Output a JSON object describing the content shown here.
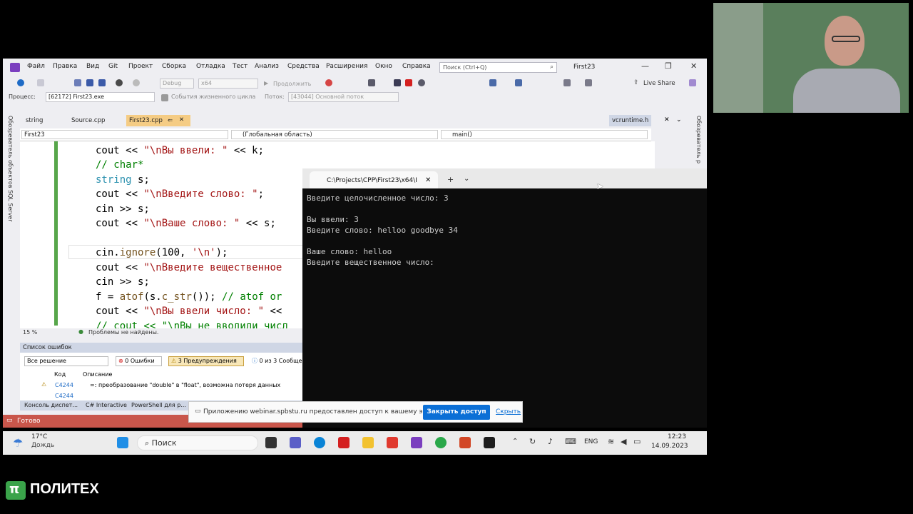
{
  "vs": {
    "menu": [
      "Файл",
      "Правка",
      "Вид",
      "Git",
      "Проект",
      "Сборка",
      "Отладка",
      "Тест",
      "Анализ",
      "Средства",
      "Расширения",
      "Окно",
      "Справка"
    ],
    "search_placeholder": "Поиск (Ctrl+Q)",
    "solution_title": "First23",
    "toolbar": {
      "config": "Debug",
      "platform": "x64",
      "continue_label": "Продолжить",
      "live_share": "Live Share",
      "process_label": "Процесс:",
      "process_value": "[62172] First23.exe",
      "lifecycle_events": "События жизненного цикла",
      "thread_label": "Поток:",
      "thread_value": "[43044] Основной поток"
    },
    "doc_tabs": [
      "string",
      "Source.cpp",
      "First23.cpp",
      "vcruntime.h"
    ],
    "left_strip_text": "Обозреватель объектов SQL Server",
    "right_strip_text": "Обозреватель р",
    "nav": {
      "project": "First23",
      "scope": "(Глобальная область)",
      "member": "main()"
    },
    "code": {
      "l1": {
        "a": "cout << ",
        "b": "\"\\nВы ввели: \"",
        "c": " << k;"
      },
      "l2": "// char*",
      "l3": {
        "a": "string",
        "b": " s;"
      },
      "l4": {
        "a": "cout << ",
        "b": "\"\\nВведите слово: \"",
        "c": ";"
      },
      "l5": "cin >> s;",
      "l6": {
        "a": "cout << ",
        "b": "\"\\nВаше слово: \"",
        "c": " << s;"
      },
      "l7": {
        "a": "cin.",
        "b": "ignore",
        "c": "(100, ",
        "d": "'\\n'",
        "e": ");"
      },
      "l8": {
        "a": "cout << ",
        "b": "\"\\nВведите вещественное"
      },
      "l9": "cin >> s;",
      "l10": {
        "a": "f = ",
        "b": "atof",
        "c": "(s.",
        "d": "c_str",
        "e": "()); ",
        "f": "// atof or"
      },
      "l11": {
        "a": "cout << ",
        "b": "\"\\nВы ввели число: \"",
        "c": " <<"
      },
      "l12": "// cout << \"\\nВы не вводили числ"
    },
    "editor_status": {
      "zoom": "15 %",
      "problems": "Проблемы не найдены."
    },
    "error_list": {
      "title": "Список ошибок",
      "scope": "Все решение",
      "errors": "0 Ошибки",
      "warnings": "3 Предупреждения",
      "messages": "0 из 3 Сообще",
      "col_code": "Код",
      "col_desc": "Описание",
      "row_code": "C4244",
      "row_desc": "=: преобразование \"double\" в \"float\", возможна потеря данных",
      "row2_code": "C4244"
    },
    "bottom_tabs": [
      "Консоль диспет...",
      "C# Interactive",
      "PowerShell для р..."
    ],
    "status": "Готово"
  },
  "console": {
    "tab_title": "C:\\Projects\\CPP\\First23\\x64\\I",
    "lines": [
      "Введите целочисленное число: 3",
      "",
      "Вы ввели: 3",
      "Введите слово: helloo goodbye 34",
      "",
      "Ваше слово: helloo",
      "Введите вещественное число: "
    ]
  },
  "notification": {
    "text": "Приложению webinar.spbstu.ru предоставлен доступ к вашему экрану.",
    "button": "Закрыть доступ",
    "hide": "Скрыть"
  },
  "taskbar": {
    "temp": "17°C",
    "weather": "Дождь",
    "search": "Поиск",
    "lang": "ENG",
    "time": "12:23",
    "date": "14.09.2023"
  },
  "logo": "ПОЛИТЕХ",
  "colors": {
    "accent": "#7b3fbf",
    "status_bar": "#c9564b",
    "tab_active": "#f5cc84",
    "button": "#0b6fd6"
  }
}
